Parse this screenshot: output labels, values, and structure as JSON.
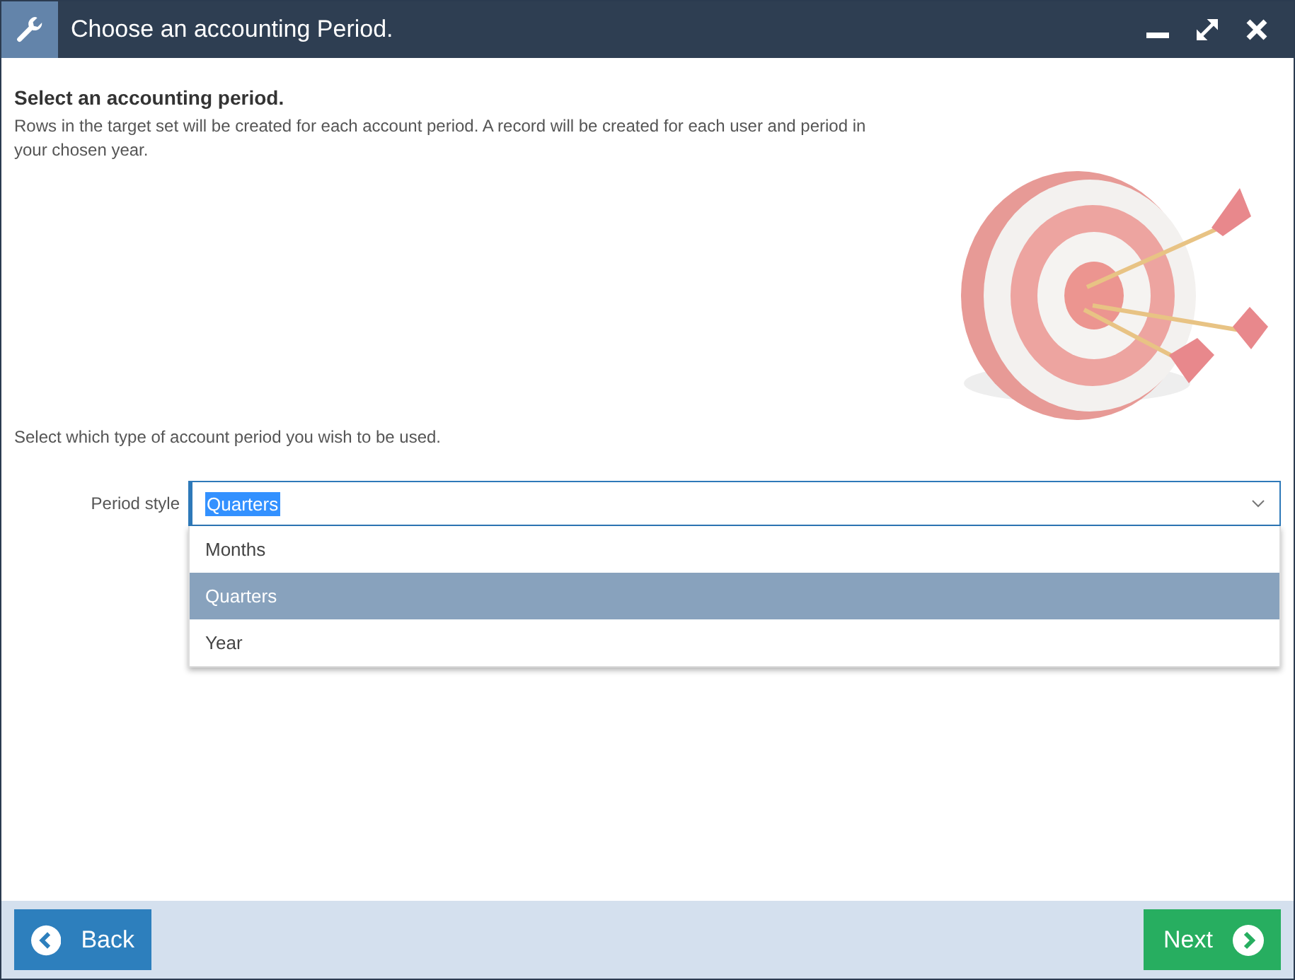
{
  "window": {
    "title": "Choose an accounting Period."
  },
  "heading": "Select an accounting period.",
  "description": "Rows in the target set will be created for each account period. A record will be created for each user and period in your chosen year.",
  "instruction": "Select which type of account period you wish to be used.",
  "period_style": {
    "label": "Period style",
    "value": "Quarters",
    "expanded": true,
    "options": [
      {
        "label": "Months",
        "selected": false
      },
      {
        "label": "Quarters",
        "selected": true
      },
      {
        "label": "Year",
        "selected": false
      }
    ]
  },
  "buttons": {
    "back": "Back",
    "next": "Next"
  }
}
